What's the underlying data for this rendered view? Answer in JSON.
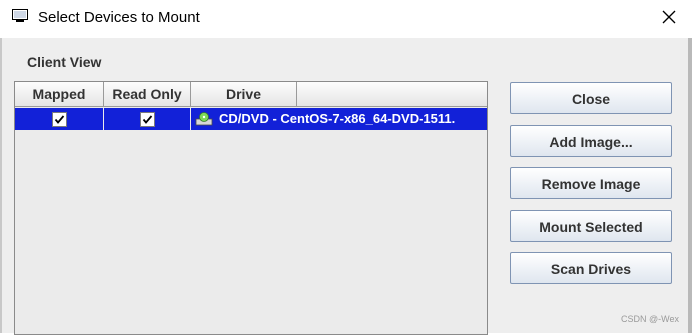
{
  "window": {
    "title": "Select Devices to Mount"
  },
  "client_view": {
    "label": "Client View"
  },
  "table": {
    "columns": [
      "Mapped",
      "Read Only",
      "Drive"
    ],
    "rows": [
      {
        "mapped": true,
        "read_only": true,
        "drive": "CD/DVD - CentOS-7-x86_64-DVD-1511.",
        "selected": true
      }
    ]
  },
  "buttons": {
    "close": "Close",
    "add_image": "Add Image...",
    "remove_image": "Remove Image",
    "mount_selected": "Mount Selected",
    "scan_drives": "Scan Drives"
  },
  "watermark": "CSDN @-Wex",
  "colors": {
    "selection": "#1221d8",
    "button_border": "#7f94b3",
    "dialog_bg": "#eeeeee"
  },
  "icons": {
    "app": "monitor-icon",
    "close": "close-icon",
    "drive": "cd-drive-icon",
    "check": "checkmark-icon"
  }
}
